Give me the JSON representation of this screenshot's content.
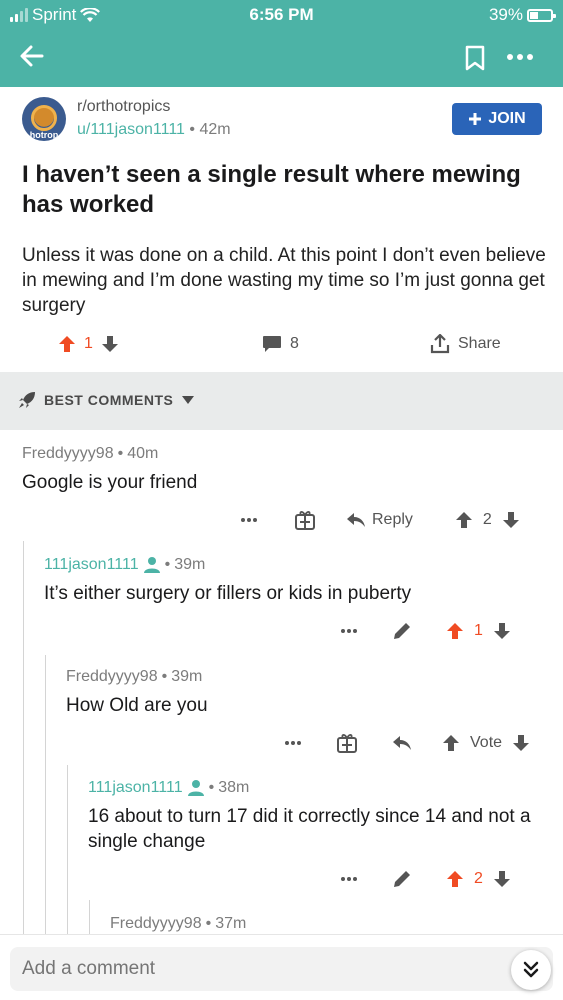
{
  "status": {
    "carrier": "Sprint",
    "time": "6:56 PM",
    "battery": "39%",
    "battery_level": 0.39
  },
  "header": {
    "bg_color": "#4cb3a6",
    "back_icon": "arrow-left-icon",
    "bookmark_icon": "bookmark-icon",
    "more_icon": "more-icon"
  },
  "post": {
    "avatar_label": "hotrop",
    "subreddit": "r/orthotropics",
    "author": "u/111jason1111",
    "age": "42m",
    "join_label": "JOIN",
    "title": "I haven’t seen a single result where mewing has worked",
    "body": "Unless it was done on a child. At this point I don’t even believe in mewing and I’m done wasting my time so I’m just gonna get surgery",
    "votes": "1",
    "comments": "8",
    "share_label": "Share"
  },
  "sort": {
    "label": "BEST COMMENTS"
  },
  "comments": [
    {
      "author": "Freddyyyy98",
      "age": "40m",
      "text": "Google is your friend",
      "reply_label": "Reply",
      "votes": "2"
    },
    {
      "author": "111jason1111",
      "age": "39m",
      "text": "It’s either surgery or fillers or kids in puberty",
      "votes": "1"
    },
    {
      "author": "Freddyyyy98",
      "age": "39m",
      "text": "How Old are you",
      "vote_label": "Vote"
    },
    {
      "author": "111jason1111",
      "age": "38m",
      "text": "16 about to turn 17 did it correctly since 14 and not a single change",
      "votes": "2"
    },
    {
      "author": "Freddyyyy98",
      "age": "37m"
    }
  ],
  "bottom": {
    "placeholder": "Add a comment"
  },
  "colors": {
    "accent": "#4cb3a6",
    "upvote": "#f04b23",
    "join": "#2a64b8"
  }
}
